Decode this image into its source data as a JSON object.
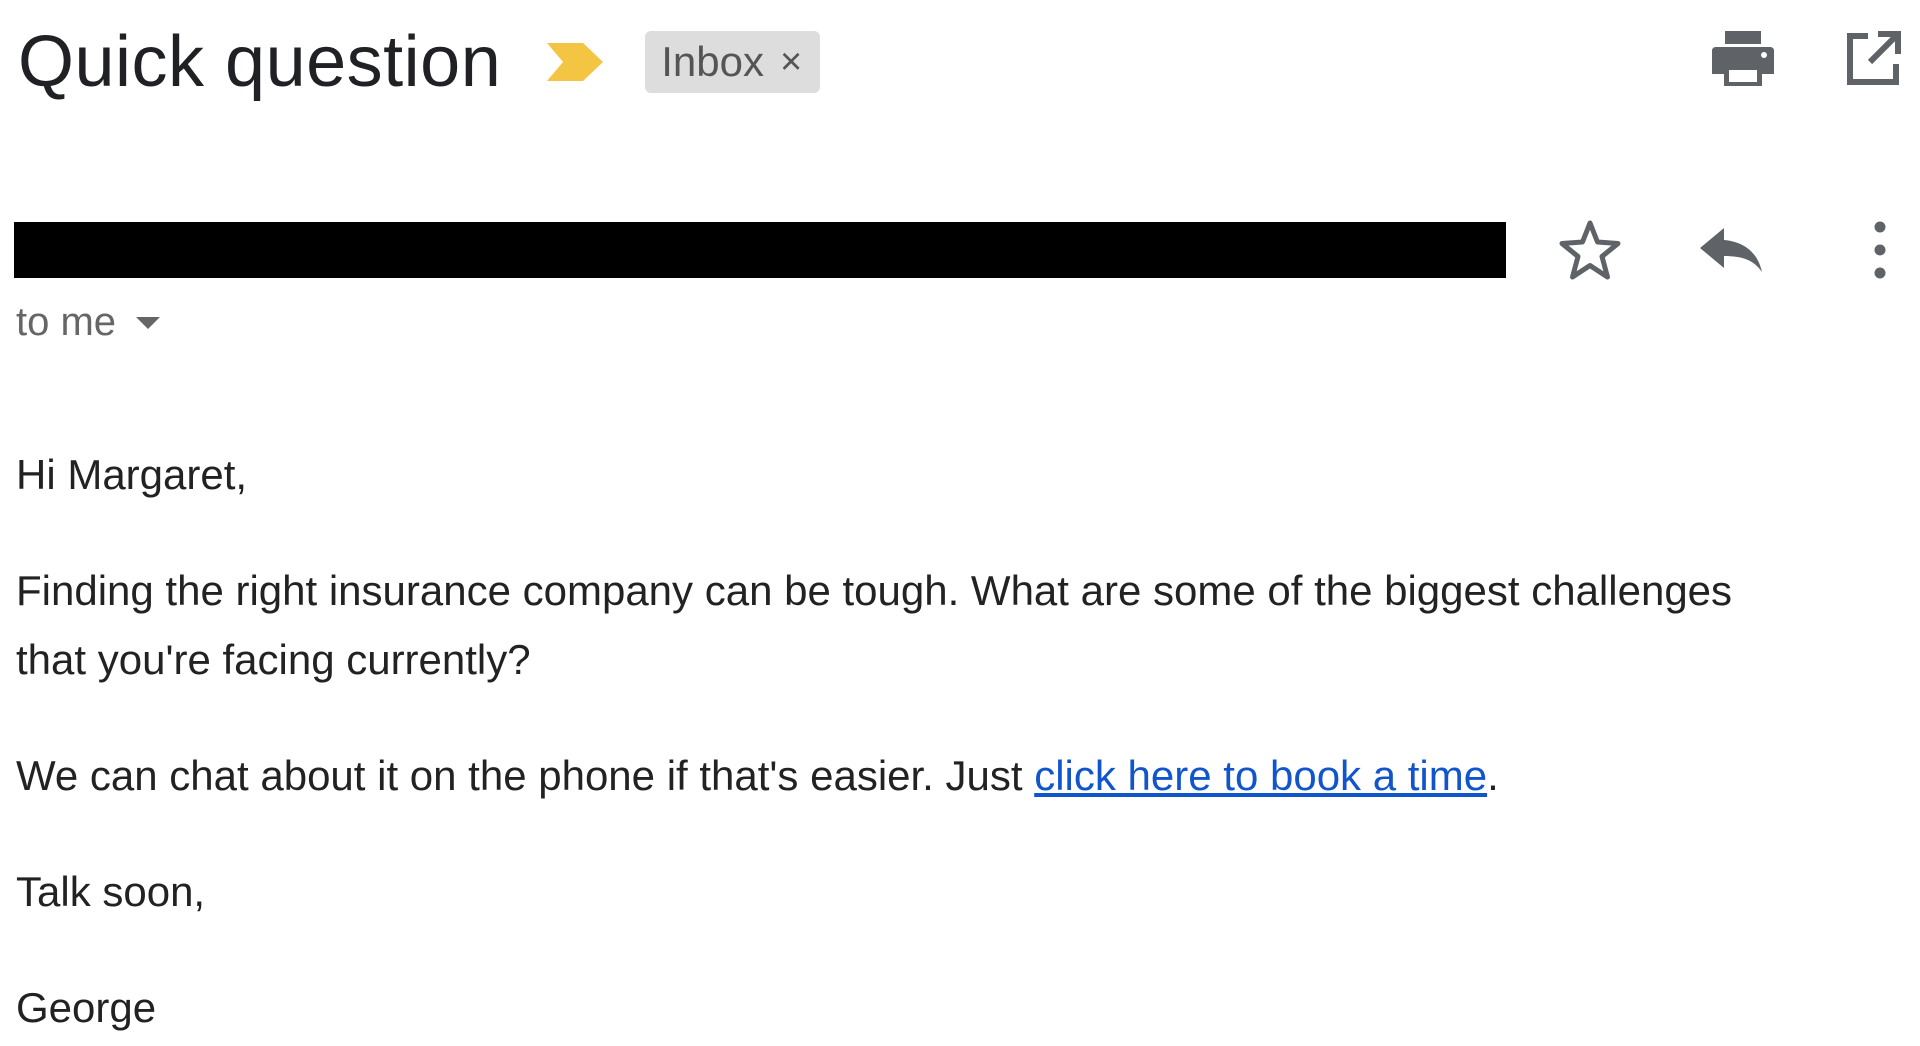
{
  "email": {
    "subject": "Quick question",
    "label": "Inbox",
    "label_remove": "×",
    "recipient": "to me",
    "greeting": "Hi Margaret,",
    "paragraph1": "Finding the right insurance company can be tough. What are some of the biggest challenges that you're facing currently?",
    "paragraph2_prefix": "We can chat about it on the phone if that's easier. Just ",
    "paragraph2_link": "click here to book a time",
    "paragraph2_suffix": ".",
    "closing": "Talk soon,",
    "signature": "George"
  },
  "icons": {
    "importance": "importance-marker-icon",
    "print": "print-icon",
    "open_new_window": "open-in-new-window-icon",
    "star": "star-icon",
    "reply": "reply-icon",
    "more": "more-vertical-icon"
  },
  "colors": {
    "importance_marker": "#f4c542",
    "link": "#1155cc",
    "label_chip_bg": "#dddddd",
    "redaction": "#000000"
  }
}
